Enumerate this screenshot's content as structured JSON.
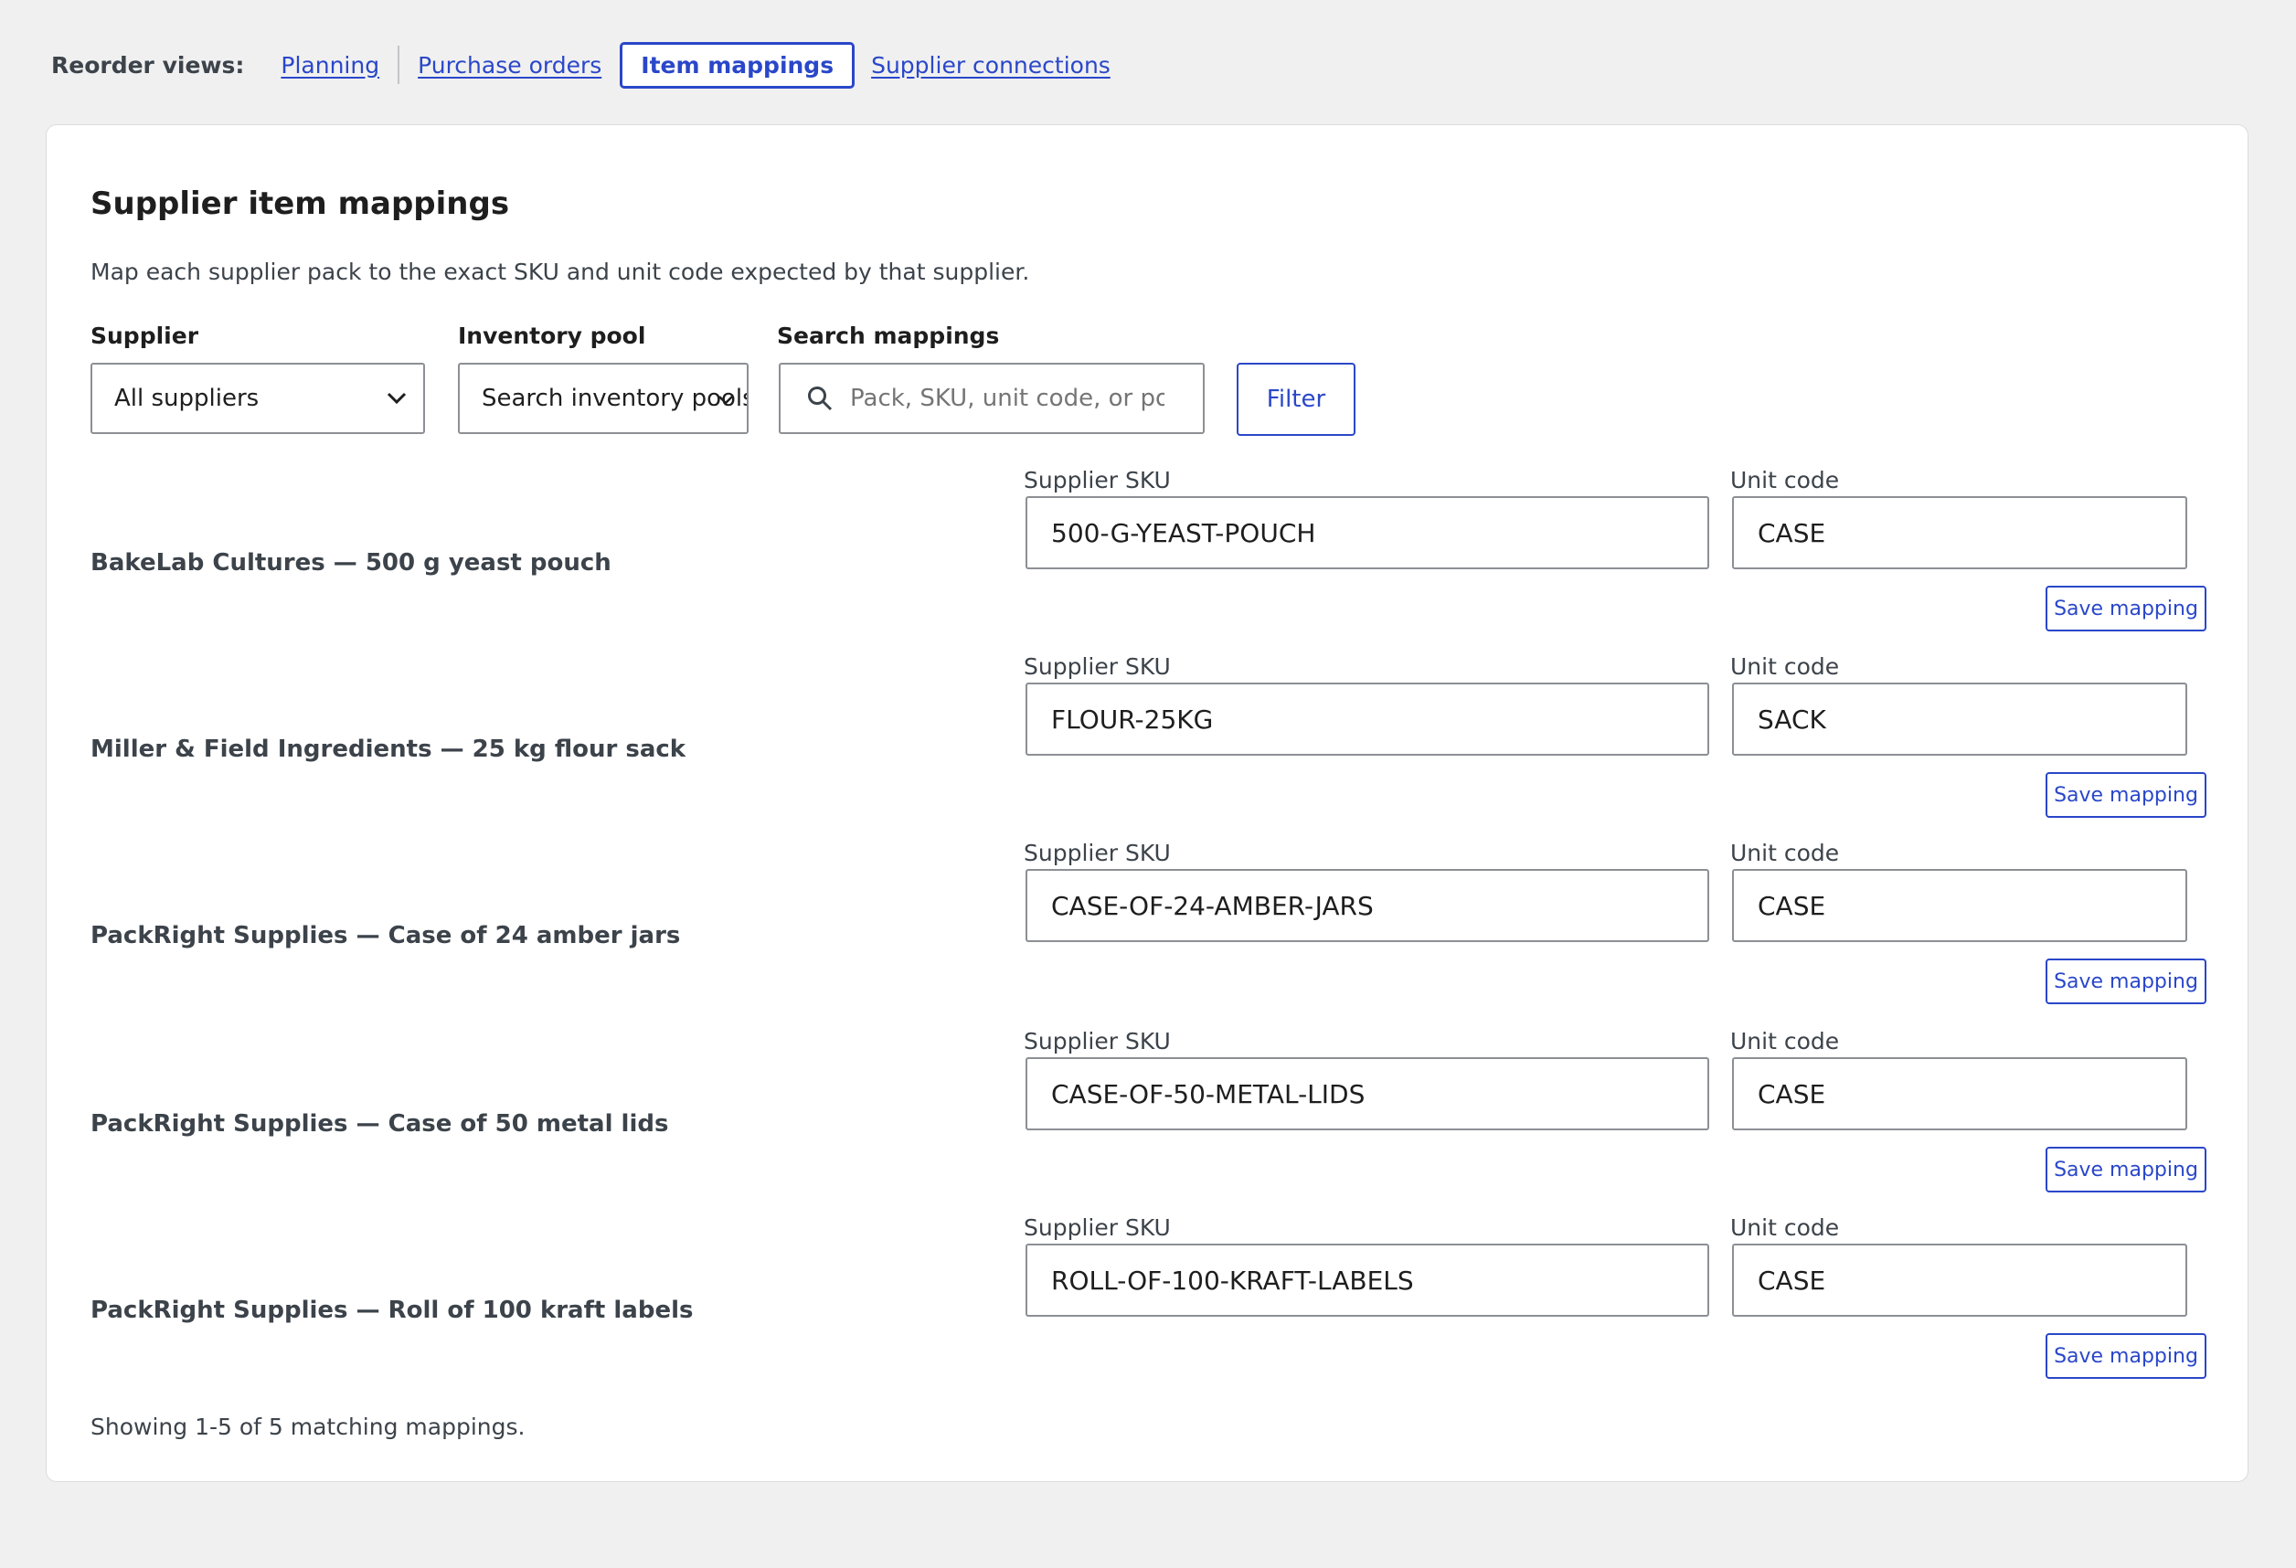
{
  "nav": {
    "label": "Reorder views:",
    "links": [
      "Planning",
      "Purchase orders",
      "Item mappings",
      "Supplier connections"
    ],
    "current": "Item mappings"
  },
  "card": {
    "title": "Supplier item mappings",
    "description": "Map each supplier pack to the exact SKU and unit code expected by that supplier."
  },
  "filters": {
    "supplier_label": "Supplier",
    "supplier_value": "All suppliers",
    "pool_label": "Inventory pool",
    "pool_value": "Search inventory pools",
    "search_label": "Search mappings",
    "search_placeholder": "Pack, SKU, unit code, or pool",
    "filter_button": "Filter"
  },
  "field_labels": {
    "sku": "Supplier SKU",
    "unit": "Unit code"
  },
  "save_label": "Save mapping",
  "rows": [
    {
      "name": "BakeLab Cultures — 500 g yeast pouch",
      "sku": "500-G-YEAST-POUCH",
      "unit": "CASE"
    },
    {
      "name": "Miller & Field Ingredients — 25 kg flour sack",
      "sku": "FLOUR-25KG",
      "unit": "SACK"
    },
    {
      "name": "PackRight Supplies — Case of 24 amber jars",
      "sku": "CASE-OF-24-AMBER-JARS",
      "unit": "CASE"
    },
    {
      "name": "PackRight Supplies — Case of 50 metal lids",
      "sku": "CASE-OF-50-METAL-LIDS",
      "unit": "CASE"
    },
    {
      "name": "PackRight Supplies — Roll of 100 kraft labels",
      "sku": "ROLL-OF-100-KRAFT-LABELS",
      "unit": "CASE"
    }
  ],
  "footer": "Showing 1-5 of 5 matching mappings."
}
